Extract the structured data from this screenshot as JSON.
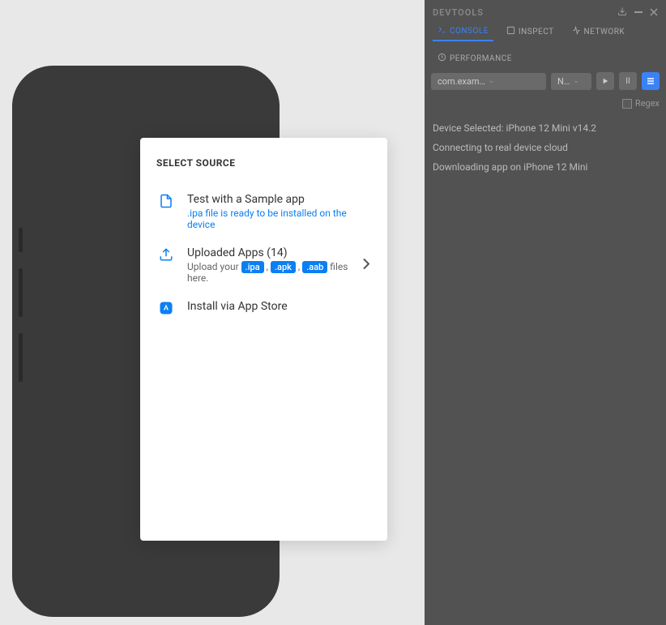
{
  "devtools": {
    "title": "DEVTOOLS",
    "tabs": {
      "console": "CONSOLE",
      "inspect": "INSPECT",
      "network": "NETWORK",
      "performance": "PERFORMANCE"
    },
    "dropdown1": "com.exam…",
    "dropdown2": "N…",
    "search_placeholder": "",
    "regex_label": "Regex",
    "console": {
      "line1": "Device Selected: iPhone 12 Mini v14.2",
      "line2": "Connecting to real device cloud",
      "line3": "Downloading app on iPhone 12 Mini"
    },
    "buttons": {
      "pause": "II"
    }
  },
  "modal": {
    "title": "SELECT SOURCE",
    "items": {
      "sample": {
        "label": "Test with a Sample app",
        "sub": ".ipa file is ready to be installed on the device"
      },
      "uploaded": {
        "label": "Uploaded Apps (14)",
        "sub_prefix": "Upload your ",
        "ext1": ".ipa",
        "sep1": " , ",
        "ext2": ".apk",
        "sep2": " , ",
        "ext3": ".aab",
        "sub_suffix": " files here."
      },
      "appstore": {
        "label": "Install via App Store"
      }
    }
  }
}
